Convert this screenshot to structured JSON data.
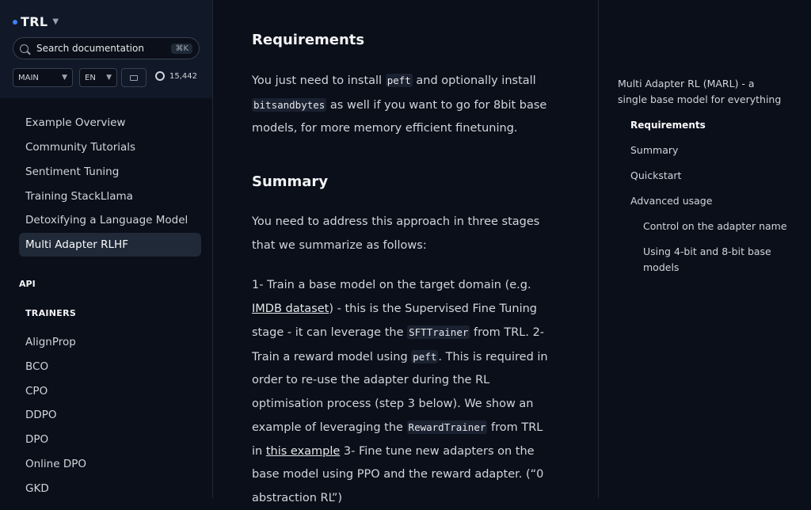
{
  "brand": {
    "name": "TRL"
  },
  "search": {
    "placeholder": "Search documentation",
    "shortcut": "⌘K"
  },
  "version_select": {
    "value": "MAIN"
  },
  "language_select": {
    "value": "EN"
  },
  "github": {
    "stars": "15,442"
  },
  "sidebar": {
    "items": [
      {
        "label": "Example Overview"
      },
      {
        "label": "Community Tutorials"
      },
      {
        "label": "Sentiment Tuning"
      },
      {
        "label": "Training StackLlama"
      },
      {
        "label": "Detoxifying a Language Model"
      },
      {
        "label": "Multi Adapter RLHF"
      }
    ],
    "api_heading": "API",
    "trainers_heading": "TRAINERS",
    "trainers": [
      {
        "label": "AlignProp"
      },
      {
        "label": "BCO"
      },
      {
        "label": "CPO"
      },
      {
        "label": "DDPO"
      },
      {
        "label": "DPO"
      },
      {
        "label": "Online DPO"
      },
      {
        "label": "GKD"
      }
    ]
  },
  "main": {
    "requirements_title": "Requirements",
    "req_t1": "You just need to install ",
    "req_code1": "peft",
    "req_t2": " and optionally install ",
    "req_code2": "bitsandbytes",
    "req_t3": " as well if you want to go for 8bit base models, for more memory efficient finetuning.",
    "summary_title": "Summary",
    "summary_intro": "You need to address this approach in three stages that we summarize as follows:",
    "s_t1": "1- Train a base model on the target domain (e.g. ",
    "s_link1": "IMDB dataset",
    "s_t2": ") - this is the Supervised Fine Tuning stage - it can leverage the ",
    "s_code1": "SFTTrainer",
    "s_t3": " from TRL. 2- Train a reward model using ",
    "s_code2": "peft",
    "s_t4": ". This is required in order to re-use the adapter during the RL optimisation process (step 3 below). We show an example of leveraging the ",
    "s_code3": "RewardTrainer",
    "s_t5": " from TRL in ",
    "s_link2": "this example",
    "s_t6": " 3- Fine tune new adapters on the base model using PPO and the reward adapter. (“0 abstraction RL”)"
  },
  "toc": {
    "items": [
      {
        "label": "Multi Adapter RL (MARL) - a single base model for everything"
      },
      {
        "label": "Requirements"
      },
      {
        "label": "Summary"
      },
      {
        "label": "Quickstart"
      },
      {
        "label": "Advanced usage"
      },
      {
        "label": "Control on the adapter name"
      },
      {
        "label": "Using 4-bit and 8-bit base models"
      }
    ]
  }
}
